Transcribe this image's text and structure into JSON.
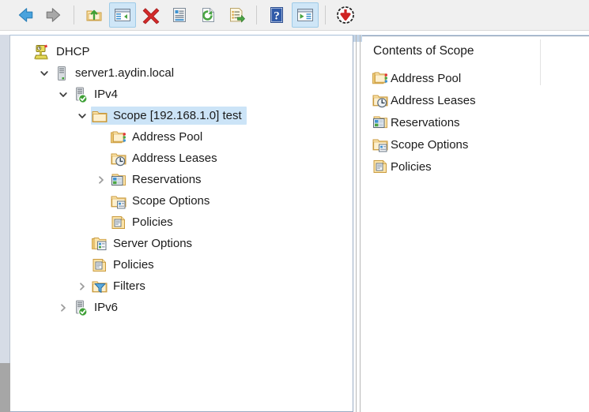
{
  "toolbar": {
    "buttons": [
      {
        "name": "back-button",
        "icon": "arrow-left-icon",
        "label": "Back",
        "active": false,
        "sep_after": false
      },
      {
        "name": "forward-button",
        "icon": "arrow-right-icon",
        "label": "Forward",
        "active": false,
        "sep_after": true
      },
      {
        "name": "up-one-level-button",
        "icon": "folder-up-icon",
        "label": "Up One Level",
        "active": false,
        "sep_after": false
      },
      {
        "name": "show-hide-console-tree-button",
        "icon": "console-tree-icon",
        "label": "Show/Hide Console Tree",
        "active": true,
        "sep_after": false
      },
      {
        "name": "delete-button",
        "icon": "red-x-icon",
        "label": "Delete",
        "active": false,
        "sep_after": false
      },
      {
        "name": "properties-button",
        "icon": "properties-icon",
        "label": "Properties",
        "active": false,
        "sep_after": false
      },
      {
        "name": "refresh-button",
        "icon": "refresh-icon",
        "label": "Refresh",
        "active": false,
        "sep_after": false
      },
      {
        "name": "export-list-button",
        "icon": "export-list-icon",
        "label": "Export List",
        "active": false,
        "sep_after": true
      },
      {
        "name": "help-button",
        "icon": "help-question-icon",
        "label": "Help",
        "active": false,
        "sep_after": false
      },
      {
        "name": "show-hide-action-pane-button",
        "icon": "action-pane-icon",
        "label": "Show/Hide Action Pane",
        "active": true,
        "sep_after": true
      },
      {
        "name": "download-button",
        "icon": "download-circle-icon",
        "label": "Download",
        "active": false,
        "sep_after": false
      }
    ]
  },
  "tree": {
    "nodes": [
      {
        "label": "DHCP",
        "icon": "dhcp-root-icon",
        "indent": 0,
        "expander": "none",
        "selected": false
      },
      {
        "label": "server1.aydin.local",
        "icon": "server-icon",
        "indent": 1,
        "expander": "expanded",
        "selected": false
      },
      {
        "label": "IPv4",
        "icon": "server-ok-icon",
        "indent": 2,
        "expander": "expanded",
        "selected": false
      },
      {
        "label": "Scope [192.168.1.0] test",
        "icon": "folder-icon",
        "indent": 3,
        "expander": "expanded",
        "selected": true
      },
      {
        "label": "Address Pool",
        "icon": "address-pool-icon",
        "indent": 4,
        "expander": "none",
        "selected": false
      },
      {
        "label": "Address Leases",
        "icon": "address-leases-icon",
        "indent": 4,
        "expander": "none",
        "selected": false
      },
      {
        "label": "Reservations",
        "icon": "reservations-icon",
        "indent": 4,
        "expander": "collapsed",
        "selected": false
      },
      {
        "label": "Scope Options",
        "icon": "scope-options-icon",
        "indent": 4,
        "expander": "none",
        "selected": false
      },
      {
        "label": "Policies",
        "icon": "policies-icon",
        "indent": 4,
        "expander": "none",
        "selected": false
      },
      {
        "label": "Server Options",
        "icon": "server-options-icon",
        "indent": 3,
        "expander": "none",
        "selected": false
      },
      {
        "label": "Policies",
        "icon": "policies-icon",
        "indent": 3,
        "expander": "none",
        "selected": false
      },
      {
        "label": "Filters",
        "icon": "filters-icon",
        "indent": 3,
        "expander": "collapsed",
        "selected": false
      },
      {
        "label": "IPv6",
        "icon": "server-ok-icon",
        "indent": 2,
        "expander": "collapsed",
        "selected": false
      }
    ]
  },
  "list": {
    "header": "Contents of Scope",
    "items": [
      {
        "label": "Address Pool",
        "icon": "address-pool-icon"
      },
      {
        "label": "Address Leases",
        "icon": "address-leases-icon"
      },
      {
        "label": "Reservations",
        "icon": "reservations-icon"
      },
      {
        "label": "Scope Options",
        "icon": "scope-options-icon"
      },
      {
        "label": "Policies",
        "icon": "policies-icon"
      }
    ]
  },
  "colors": {
    "selection": "#cce4f7",
    "toolbar_bg": "#f0f0f0",
    "active_button": "#cfe6f7",
    "panel_top_band": "#c3d5e8",
    "folder": "#fbe3a8",
    "folder_edge": "#d9a441",
    "status_green": "#3fa037",
    "accent_blue": "#3f93d1"
  }
}
